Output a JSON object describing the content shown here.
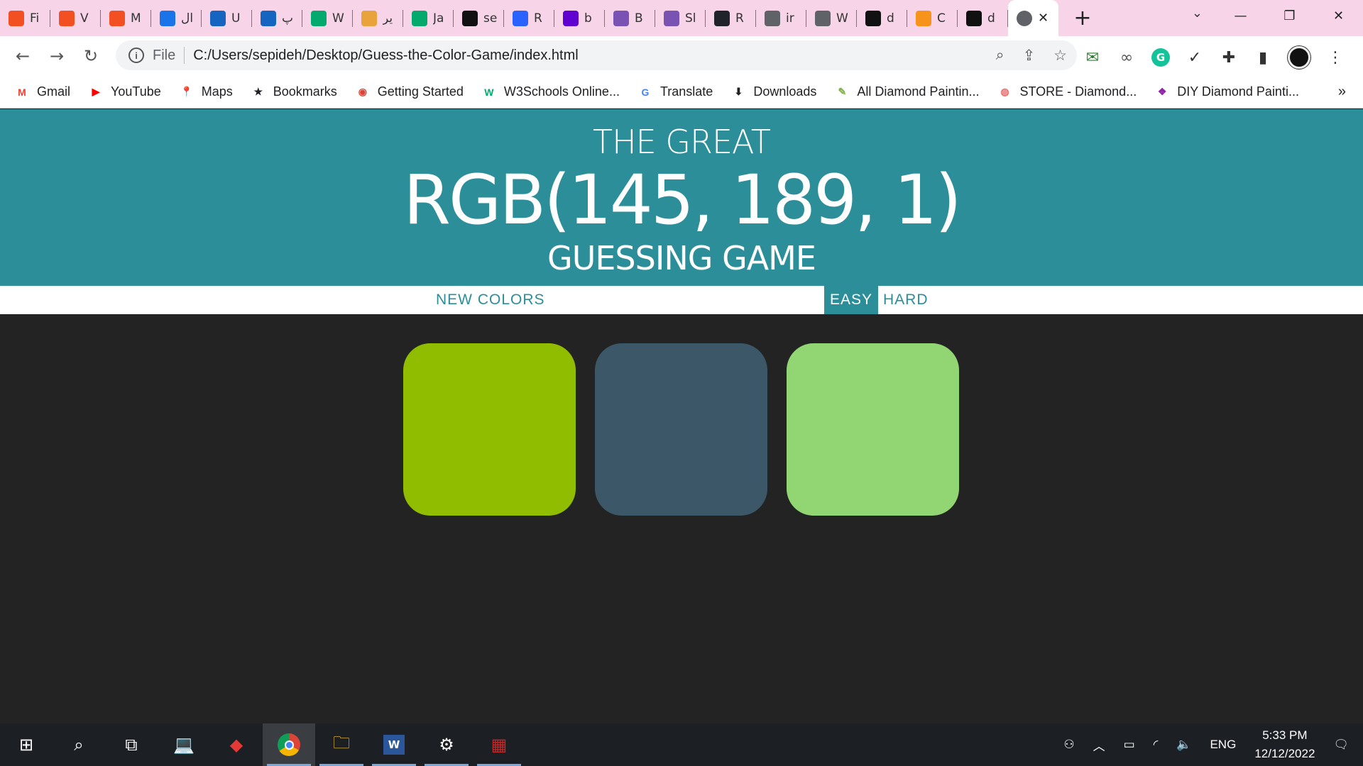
{
  "browser": {
    "tabs": [
      {
        "icon": "microsoft-icon",
        "title": "Fi",
        "color": "#f25022"
      },
      {
        "icon": "microsoft-icon",
        "title": "V",
        "color": "#f25022"
      },
      {
        "icon": "microsoft-icon",
        "title": "M",
        "color": "#f25022"
      },
      {
        "icon": "q-icon",
        "title": "ال",
        "color": "#1a73e8"
      },
      {
        "icon": "hexagon-icon",
        "title": "U",
        "color": "#1565c0"
      },
      {
        "icon": "hexagon-icon",
        "title": "پ",
        "color": "#1565c0"
      },
      {
        "icon": "w3schools-icon",
        "title": "W",
        "color": "#04aa6d"
      },
      {
        "icon": "upload-icon",
        "title": "یر",
        "color": "#e8a33d"
      },
      {
        "icon": "w3schools-icon",
        "title": "Ja",
        "color": "#04aa6d"
      },
      {
        "icon": "github-icon",
        "title": "se",
        "color": "#111111"
      },
      {
        "icon": "flag-icon",
        "title": "R",
        "color": "#2962ff"
      },
      {
        "icon": "yahoo-icon",
        "title": "b",
        "color": "#6001d2"
      },
      {
        "icon": "bootstrap-icon",
        "title": "B",
        "color": "#7952b3"
      },
      {
        "icon": "bootstrap-icon",
        "title": "Sl",
        "color": "#7952b3"
      },
      {
        "icon": "react-icon",
        "title": "R",
        "color": "#20232a"
      },
      {
        "icon": "globe-icon",
        "title": "ir",
        "color": "#5f6368"
      },
      {
        "icon": "globe-icon",
        "title": "W",
        "color": "#5f6368"
      },
      {
        "icon": "github-icon",
        "title": "d",
        "color": "#111111"
      },
      {
        "icon": "coin-icon",
        "title": "C",
        "color": "#f7931a"
      },
      {
        "icon": "github-icon",
        "title": "d",
        "color": "#111111"
      }
    ],
    "active_tab": {
      "icon": "globe-icon",
      "close": "✕"
    },
    "new_tab": "+",
    "url_scheme": "File",
    "url": "C:/Users/sepideh/Desktop/Guess-the-Color-Game/index.html",
    "bookmarks": [
      {
        "icon": "gmail-icon",
        "glyph": "M",
        "color": "#ea4335",
        "label": "Gmail"
      },
      {
        "icon": "youtube-icon",
        "glyph": "▶",
        "color": "#ff0000",
        "label": "YouTube"
      },
      {
        "icon": "maps-icon",
        "glyph": "📍",
        "color": "#34a853",
        "label": "Maps"
      },
      {
        "icon": "star-icon",
        "glyph": "★",
        "color": "#202124",
        "label": "Bookmarks"
      },
      {
        "icon": "chrome-icon",
        "glyph": "◉",
        "color": "#db4437",
        "label": "Getting Started"
      },
      {
        "icon": "w3schools-icon",
        "glyph": "W",
        "color": "#04aa6d",
        "label": "W3Schools Online..."
      },
      {
        "icon": "translate-icon",
        "glyph": "G",
        "color": "#4285f4",
        "label": "Translate"
      },
      {
        "icon": "download-icon",
        "glyph": "⬇",
        "color": "#202124",
        "label": "Downloads"
      },
      {
        "icon": "pencil-icon",
        "glyph": "✎",
        "color": "#7cb342",
        "label": "All Diamond Paintin..."
      },
      {
        "icon": "store-icon",
        "glyph": "◍",
        "color": "#e57373",
        "label": "STORE - Diamond..."
      },
      {
        "icon": "paint-icon",
        "glyph": "❖",
        "color": "#8e24aa",
        "label": "DIY Diamond Painti..."
      }
    ],
    "bookmarks_more": "»"
  },
  "game": {
    "title_line1": "THE GREAT",
    "rgb_display": "RGB(145, 189, 1)",
    "title_line3": "GUESSING GAME",
    "new_colors_label": "NEW COLORS",
    "message": "",
    "easy_label": "EASY",
    "hard_label": "HARD",
    "mode_selected": "EASY",
    "header_color": "#2c8e99",
    "background_color": "#232323",
    "squares": [
      {
        "color": "#91bd01"
      },
      {
        "color": "#3c5768"
      },
      {
        "color": "#91d673"
      }
    ]
  },
  "taskbar": {
    "language": "ENG",
    "time": "5:33 PM",
    "date": "12/12/2022"
  }
}
